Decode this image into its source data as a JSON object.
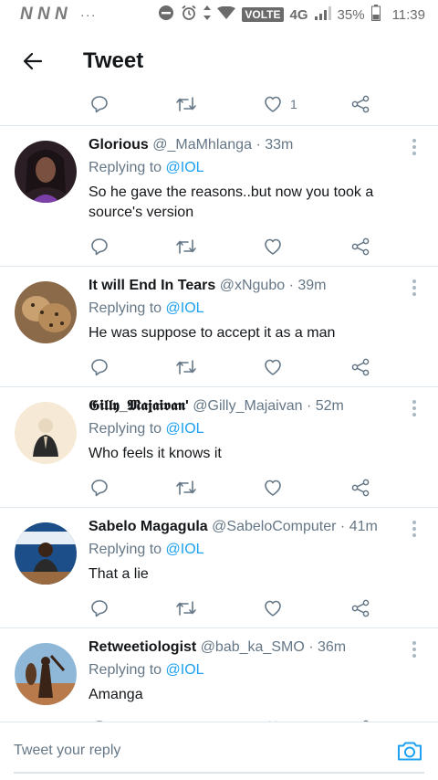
{
  "status_bar": {
    "carrier": "N N N",
    "dots": "···",
    "volte": "VOLTE",
    "network": "4G",
    "battery": "35%",
    "time": "11:39"
  },
  "header": {
    "title": "Tweet"
  },
  "top_actions": {
    "like_count": "1"
  },
  "tweets": [
    {
      "name": "Glorious",
      "handle": "@_MaMhlanga",
      "time": "· 33m",
      "replying_prefix": "Replying to",
      "replying_to": "@IOL",
      "text": "So he gave the reasons..but now you took a source's version"
    },
    {
      "name": "It will End In Tears",
      "handle": "@xNgubo",
      "time": "· 39m",
      "replying_prefix": "Replying to",
      "replying_to": "@IOL",
      "text": "He was suppose to accept it as a man"
    },
    {
      "name": "𝕲𝖎𝖑𝖑𝖞_𝕸𝖆𝖏𝖆𝖎𝖛𝖆𝖓'",
      "handle": "@Gilly_Majaivan",
      "time": "· 52m",
      "replying_prefix": "Replying to",
      "replying_to": "@IOL",
      "text": "Who feels it knows it"
    },
    {
      "name": "Sabelo Magagula",
      "handle": "@SabeloComputer",
      "time": "· 41m",
      "replying_prefix": "Replying to",
      "replying_to": "@IOL",
      "text": "That a lie"
    },
    {
      "name": "Retweetiologist",
      "handle": "@bab_ka_SMO",
      "time": "· 36m",
      "replying_prefix": "Replying to",
      "replying_to": "@IOL",
      "text": "Amanga"
    }
  ],
  "reply_bar": {
    "placeholder": "Tweet your reply"
  },
  "icons": {
    "reply": "reply-icon",
    "retweet": "retweet-icon",
    "like": "heart-icon",
    "share": "share-icon",
    "more": "more-vertical-icon",
    "camera": "camera-icon"
  },
  "colors": {
    "accent": "#1da1f2",
    "muted": "#657786",
    "divider": "#e1e8ed"
  }
}
